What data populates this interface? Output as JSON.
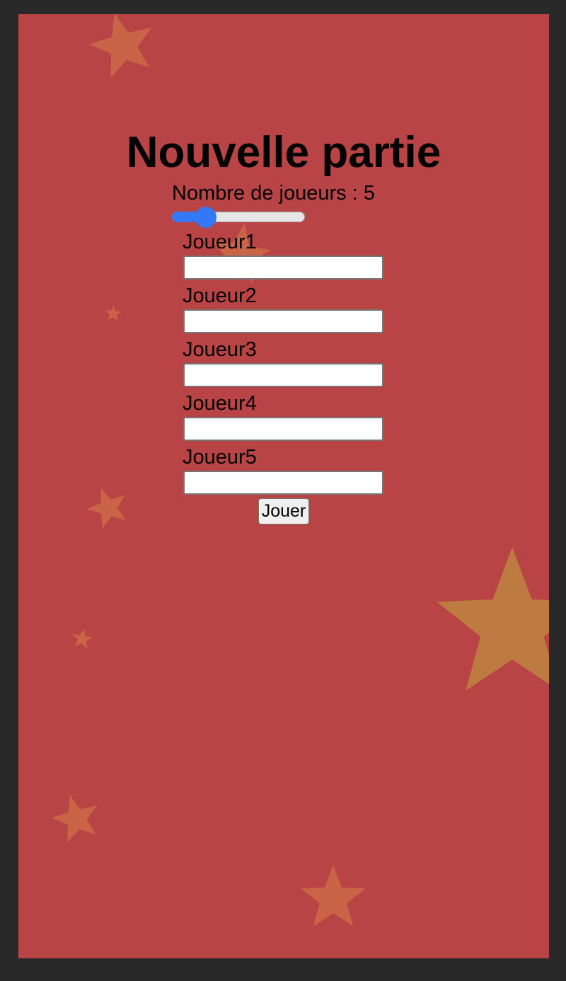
{
  "theme": {
    "background": "#b94445",
    "frame": "#292929",
    "star_color": "#c96546",
    "big_star_color": "#bd7a41",
    "slider_accent": "#3478f6"
  },
  "form": {
    "title": "Nouvelle partie",
    "player_count_label": "Nombre de joueurs : 5",
    "player_count": 5,
    "slider": {
      "min": 1,
      "max": 20,
      "value": 5
    },
    "players": [
      {
        "label": "Joueur1",
        "value": ""
      },
      {
        "label": "Joueur2",
        "value": ""
      },
      {
        "label": "Joueur3",
        "value": ""
      },
      {
        "label": "Joueur4",
        "value": ""
      },
      {
        "label": "Joueur5",
        "value": ""
      }
    ],
    "submit_label": "Jouer"
  }
}
